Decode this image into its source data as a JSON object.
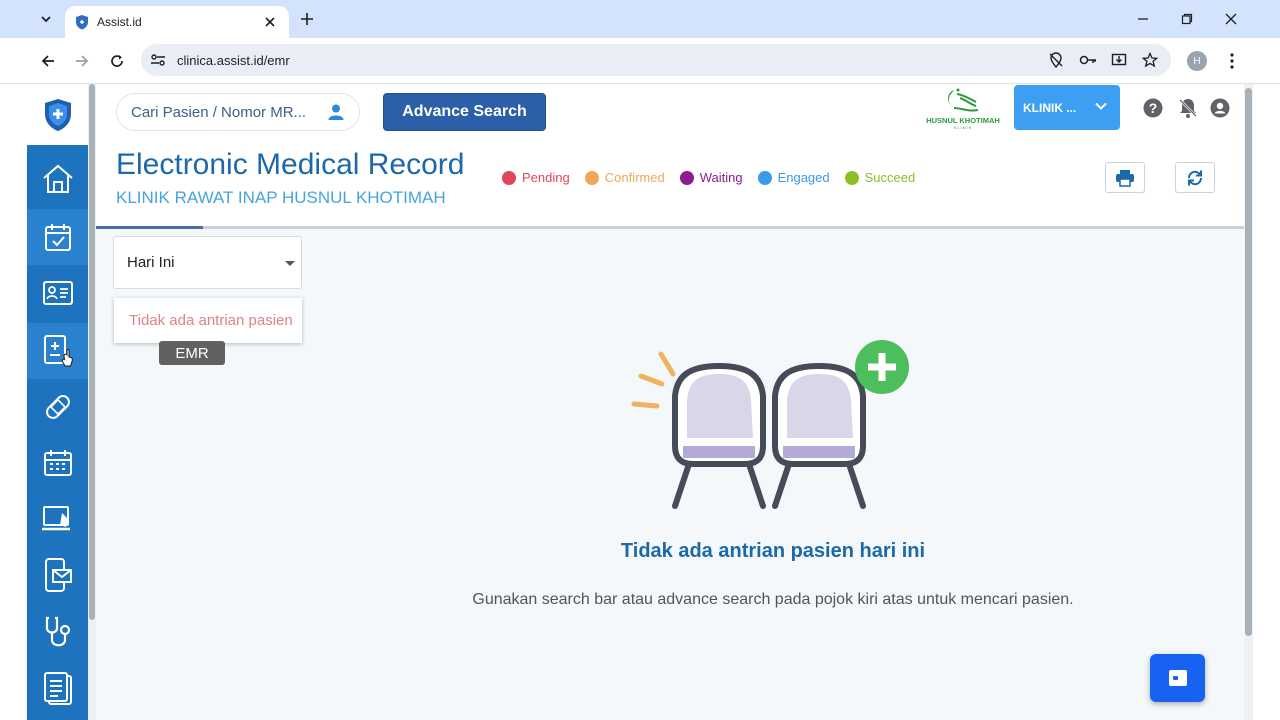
{
  "browser": {
    "tab_title": "Assist.id",
    "url": "clinica.assist.id/emr",
    "profile_initial": "H"
  },
  "header": {
    "search_placeholder": "Cari Pasien / Nomor MR...",
    "advance_search_label": "Advance Search",
    "clinic_logo_text": "HUSNUL KHOTIMAH",
    "clinic_logo_subtext": "KLINIK",
    "clinic_select_label": "KLINIK ...",
    "title": "Electronic Medical Record",
    "subtitle": "KLINIK RAWAT INAP HUSNUL KHOTIMAH"
  },
  "legend": [
    {
      "label": "Pending",
      "color": "#e0475b",
      "text_color": "#e0475b"
    },
    {
      "label": "Confirmed",
      "color": "#f2a65a",
      "text_color": "#f2a65a"
    },
    {
      "label": "Waiting",
      "color": "#8e1c8e",
      "text_color": "#8e1c8e"
    },
    {
      "label": "Engaged",
      "color": "#3b9ae8",
      "text_color": "#3b9ae8"
    },
    {
      "label": "Succeed",
      "color": "#8cbf26",
      "text_color": "#8cbf26"
    }
  ],
  "filter": {
    "selected": "Hari Ini"
  },
  "queue": {
    "empty_label": "Tidak ada antrian pasien",
    "tooltip": "EMR"
  },
  "empty_state": {
    "title": "Tidak ada antrian pasien hari ini",
    "message": "Gunakan search bar atau advance search pada pojok kiri atas untuk mencari pasien."
  },
  "sidebar": {
    "items": [
      {
        "icon": "home-icon"
      },
      {
        "icon": "calendar-icon"
      },
      {
        "icon": "patient-card-icon"
      },
      {
        "icon": "medical-record-icon"
      },
      {
        "icon": "bandage-icon"
      },
      {
        "icon": "schedule-icon"
      },
      {
        "icon": "telemedicine-icon"
      },
      {
        "icon": "mobile-mail-icon"
      },
      {
        "icon": "stethoscope-icon"
      },
      {
        "icon": "clipboard-icon"
      }
    ]
  },
  "colors": {
    "sidebar": "#1e73be",
    "primary_text": "#1c69a9",
    "accent": "#45a4e0",
    "advance_button": "#2d5ea8",
    "clinic_button": "#3d9ff2"
  }
}
